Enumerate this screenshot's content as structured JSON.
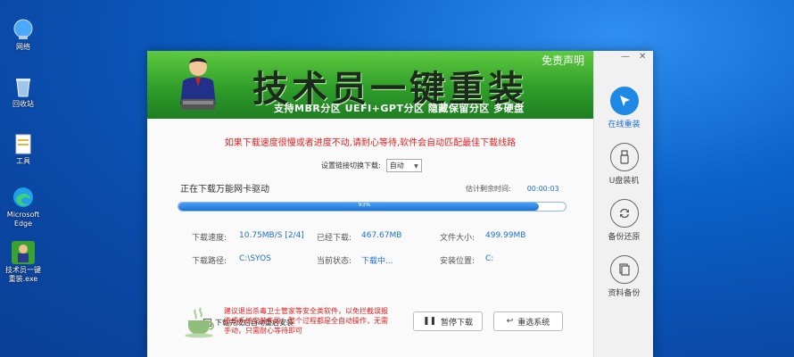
{
  "desktop": {
    "icons": [
      {
        "label": "网络",
        "icon": "network-icon"
      },
      {
        "label": "回收站",
        "icon": "recycle-bin-icon"
      },
      {
        "label": "工具",
        "icon": "folder-icon"
      },
      {
        "label": "Microsoft Edge",
        "icon": "edge-icon"
      },
      {
        "label": "技术员一键重装.exe",
        "icon": "app-shortcut-icon"
      }
    ]
  },
  "app": {
    "title": "技术员一键重装",
    "subtitle": "支持MBR分区 UEFI+GPT分区 隐藏保留分区 多硬盘",
    "disclaimer": "免责声明",
    "sidebar": [
      {
        "label": "在线重装",
        "icon": "cursor-icon",
        "active": true
      },
      {
        "label": "U盘装机",
        "icon": "usb-icon",
        "active": false
      },
      {
        "label": "备份还原",
        "icon": "restore-icon",
        "active": false
      },
      {
        "label": "资料备份",
        "icon": "backup-icon",
        "active": false
      }
    ],
    "warning": "如果下载速度很慢或者进度不动,请耐心等待,软件会自动匹配最佳下载线路",
    "link_switch_label": "设置链接切换下载:",
    "link_switch_value": "自动",
    "status_text": "正在下载万能网卡驱动",
    "time_remaining_label": "估计剩余时间:",
    "time_remaining_value": "00:00:03",
    "progress_percent": 93,
    "progress_label": "93%",
    "info": {
      "speed_label": "下载速度:",
      "speed_value": "10.75MB/S [2/4]",
      "downloaded_label": "已经下载:",
      "downloaded_value": "467.67MB",
      "filesize_label": "文件大小:",
      "filesize_value": "499.99MB",
      "path_label": "下载路径:",
      "path_value": "C:\\SYOS",
      "current_status_label": "当前状态:",
      "current_status_value": "下载中...",
      "install_loc_label": "安装位置:",
      "install_loc_value": "C:"
    },
    "auto_reboot_label": "下载完成后自动重启安装",
    "auto_reboot_checked": true,
    "tip": "建议退出杀毒卫士管家等安全类软件，以免拦截误报造成系统安装失败！整个过程都是全自动操作，无需手动，只需耐心等待即可",
    "pause_button": "暂停下载",
    "reselect_button": "重选系统"
  }
}
